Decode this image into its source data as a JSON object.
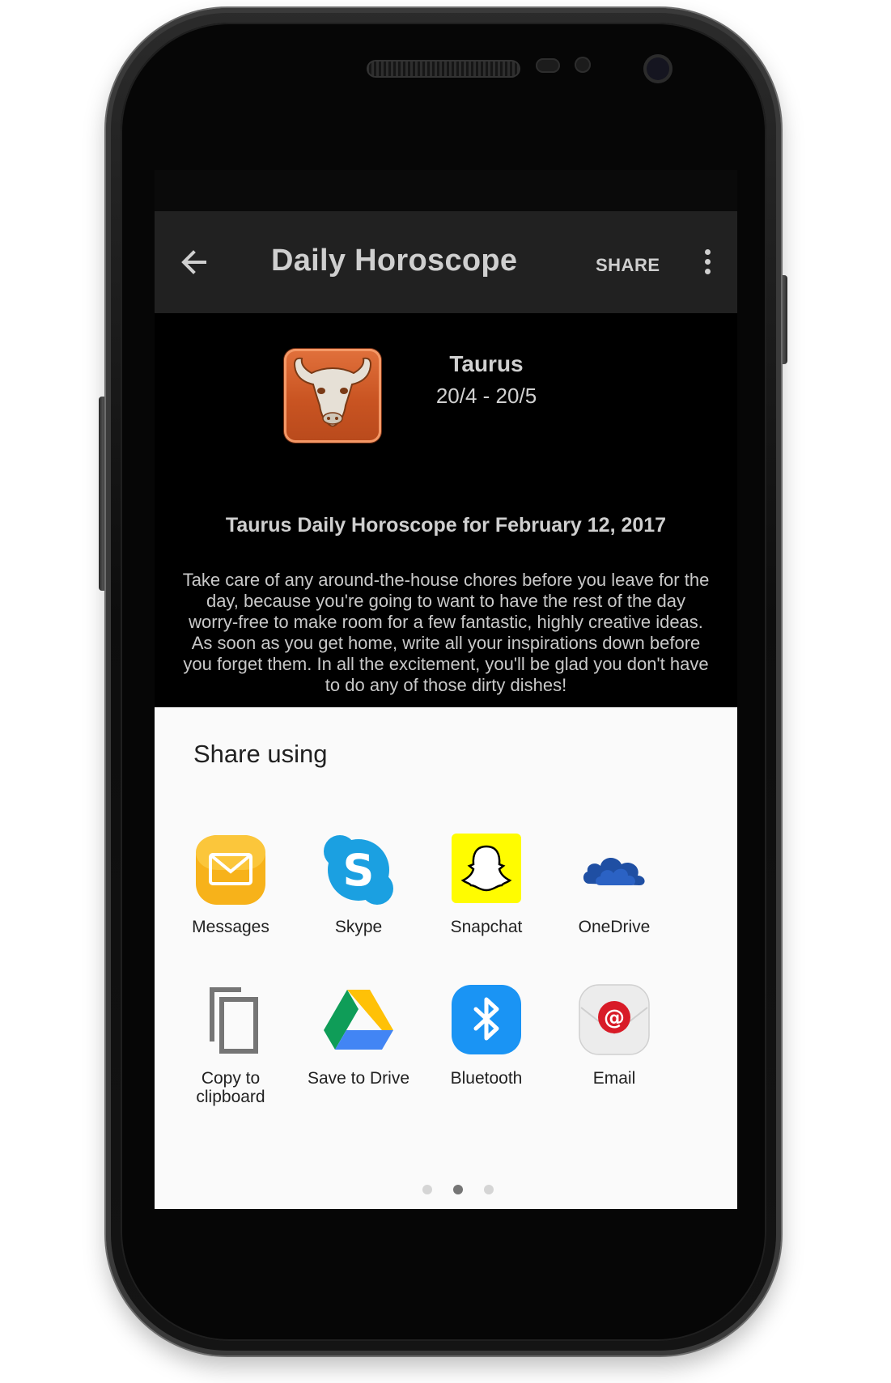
{
  "app": {
    "title": "Daily Horoscope",
    "share_action": "SHARE",
    "back_icon": "arrow-left-icon",
    "menu_icon": "more-vertical-icon"
  },
  "sign": {
    "name": "Taurus",
    "dates": "20/4 - 20/5",
    "icon": "bull-icon",
    "color": "#c95422"
  },
  "horoscope": {
    "title": "Taurus Daily Horoscope for February 12, 2017",
    "body": "Take care of any around-the-house chores before you leave for the day, because you're going to want to have the rest of the day worry-free to make room for a few fantastic, highly creative ideas. As soon as you get home, write all your inspirations down before you forget them. In all the excitement, you'll be glad you don't have to do any of those dirty dishes!"
  },
  "share_sheet": {
    "title": "Share using",
    "items": [
      {
        "label": "Messages",
        "icon": "messages-icon"
      },
      {
        "label": "Skype",
        "icon": "skype-icon"
      },
      {
        "label": "Snapchat",
        "icon": "snapchat-icon"
      },
      {
        "label": "OneDrive",
        "icon": "onedrive-icon"
      },
      {
        "label": "Copy to\nclipboard",
        "icon": "copy-icon"
      },
      {
        "label": "Save to Drive",
        "icon": "google-drive-icon"
      },
      {
        "label": "Bluetooth",
        "icon": "bluetooth-icon"
      },
      {
        "label": "Email",
        "icon": "email-icon"
      }
    ],
    "page_count": 3,
    "current_page": 2
  }
}
